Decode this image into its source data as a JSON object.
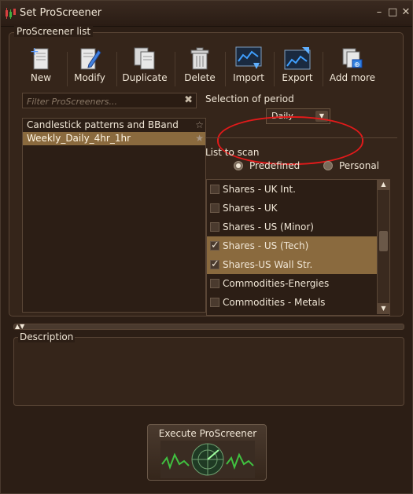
{
  "window": {
    "title": "Set ProScreener"
  },
  "list_group": {
    "label": "ProScreener list"
  },
  "toolbar": [
    {
      "label": "New"
    },
    {
      "label": "Modify"
    },
    {
      "label": "Duplicate"
    },
    {
      "label": "Delete"
    },
    {
      "label": "Import"
    },
    {
      "label": "Export"
    },
    {
      "label": "Add more"
    }
  ],
  "filter": {
    "placeholder": "Filter ProScreeners..."
  },
  "screeners": [
    {
      "name": "Candlestick patterns and BBand",
      "selected": false
    },
    {
      "name": "Weekly_Daily_4hr_1hr",
      "selected": true
    }
  ],
  "period": {
    "label": "Selection of period",
    "value": "Daily"
  },
  "scan": {
    "label": "List to scan",
    "radios": [
      {
        "label": "Predefined",
        "checked": true
      },
      {
        "label": "Personal",
        "checked": false
      }
    ],
    "items": [
      {
        "label": "Shares - UK Int.",
        "checked": false
      },
      {
        "label": "Shares - UK",
        "checked": false
      },
      {
        "label": "Shares - US (Minor)",
        "checked": false
      },
      {
        "label": "Shares - US (Tech)",
        "checked": true
      },
      {
        "label": "Shares-US Wall Str.",
        "checked": true
      },
      {
        "label": "Commodities-Energies",
        "checked": false
      },
      {
        "label": "Commodities - Metals",
        "checked": false
      }
    ]
  },
  "description": {
    "label": "Description"
  },
  "execute": {
    "label": "Execute ProScreener"
  },
  "colors": {
    "accent": "#8a6a3e",
    "background": "#2c1e15",
    "annotation": "#e21a1a"
  }
}
